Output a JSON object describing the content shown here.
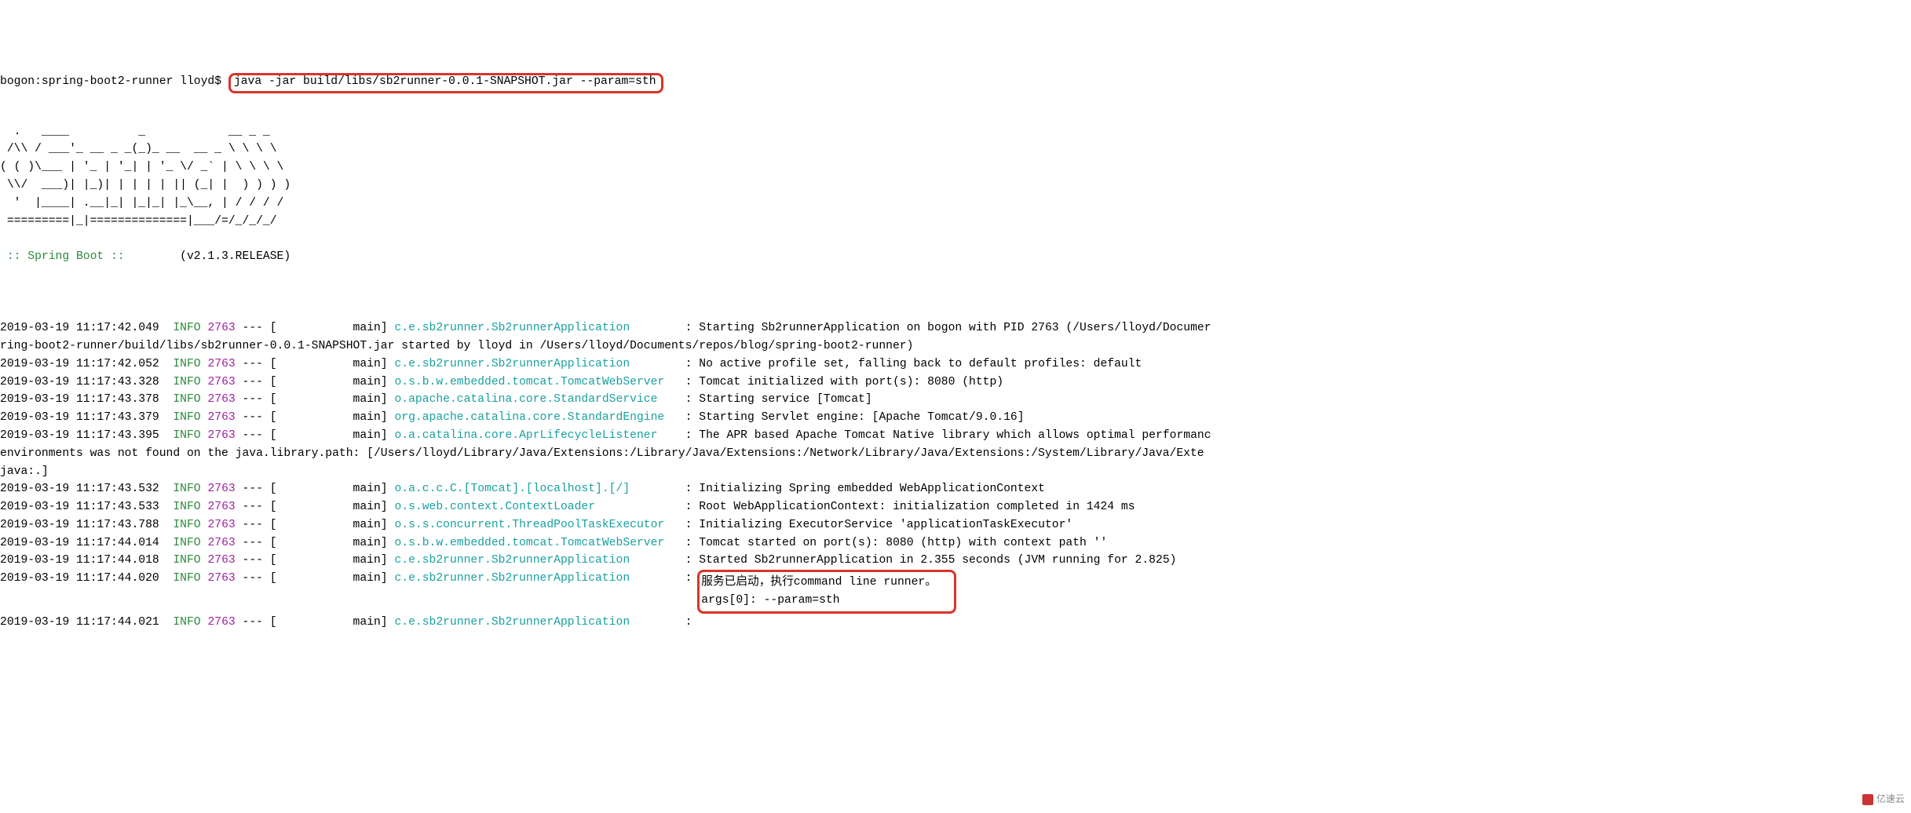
{
  "prompt": {
    "host": "bogon:spring-boot2-runner lloyd$ ",
    "command": "java -jar build/libs/sb2runner-0.0.1-SNAPSHOT.jar --param=sth"
  },
  "banner": "  .   ____          _            __ _ _\n /\\\\ / ___'_ __ _ _(_)_ __  __ _ \\ \\ \\ \\\n( ( )\\___ | '_ | '_| | '_ \\/ _` | \\ \\ \\ \\\n \\\\/  ___)| |_)| | | | | || (_| |  ) ) ) )\n  '  |____| .__|_| |_|_| |_\\__, | / / / /\n =========|_|==============|___/=/_/_/_/",
  "spring": {
    "label": " :: Spring Boot :: ",
    "version": "       (v2.1.3.RELEASE)"
  },
  "level": "INFO",
  "pid": "2763",
  "sep": " --- [           main] ",
  "lines": [
    {
      "ts": "2019-03-19 11:17:42.049",
      "logger": "c.e.sb2runner.Sb2runnerApplication       ",
      "msg": "Starting Sb2runnerApplication on bogon with PID 2763 (/Users/lloyd/Documer"
    },
    {
      "cont": "ring-boot2-runner/build/libs/sb2runner-0.0.1-SNAPSHOT.jar started by lloyd in /Users/lloyd/Documents/repos/blog/spring-boot2-runner)"
    },
    {
      "ts": "2019-03-19 11:17:42.052",
      "logger": "c.e.sb2runner.Sb2runnerApplication       ",
      "msg": "No active profile set, falling back to default profiles: default"
    },
    {
      "ts": "2019-03-19 11:17:43.328",
      "logger": "o.s.b.w.embedded.tomcat.TomcatWebServer  ",
      "msg": "Tomcat initialized with port(s): 8080 (http)"
    },
    {
      "ts": "2019-03-19 11:17:43.378",
      "logger": "o.apache.catalina.core.StandardService   ",
      "msg": "Starting service [Tomcat]"
    },
    {
      "ts": "2019-03-19 11:17:43.379",
      "logger": "org.apache.catalina.core.StandardEngine  ",
      "msg": "Starting Servlet engine: [Apache Tomcat/9.0.16]"
    },
    {
      "ts": "2019-03-19 11:17:43.395",
      "logger": "o.a.catalina.core.AprLifecycleListener   ",
      "msg": "The APR based Apache Tomcat Native library which allows optimal performanc"
    },
    {
      "cont": "environments was not found on the java.library.path: [/Users/lloyd/Library/Java/Extensions:/Library/Java/Extensions:/Network/Library/Java/Extensions:/System/Library/Java/Exte"
    },
    {
      "cont": "java:.]"
    },
    {
      "ts": "2019-03-19 11:17:43.532",
      "logger": "o.a.c.c.C.[Tomcat].[localhost].[/]       ",
      "msg": "Initializing Spring embedded WebApplicationContext"
    },
    {
      "ts": "2019-03-19 11:17:43.533",
      "logger": "o.s.web.context.ContextLoader            ",
      "msg": "Root WebApplicationContext: initialization completed in 1424 ms"
    },
    {
      "ts": "2019-03-19 11:17:43.788",
      "logger": "o.s.s.concurrent.ThreadPoolTaskExecutor  ",
      "msg": "Initializing ExecutorService 'applicationTaskExecutor'"
    },
    {
      "ts": "2019-03-19 11:17:44.014",
      "logger": "o.s.b.w.embedded.tomcat.TomcatWebServer  ",
      "msg": "Tomcat started on port(s): 8080 (http) with context path ''"
    },
    {
      "ts": "2019-03-19 11:17:44.018",
      "logger": "c.e.sb2runner.Sb2runnerApplication       ",
      "msg": "Started Sb2runnerApplication in 2.355 seconds (JVM running for 2.825)"
    },
    {
      "ts": "2019-03-19 11:17:44.020",
      "logger": "c.e.sb2runner.Sb2runnerApplication       ",
      "msg": "服务已启动，执行command line runner。",
      "boxed": "top"
    },
    {
      "ts": "2019-03-19 11:17:44.021",
      "logger": "c.e.sb2runner.Sb2runnerApplication       ",
      "msg": "args[0]: --param=sth                ",
      "boxed": "bottom"
    }
  ],
  "watermark": "亿速云"
}
